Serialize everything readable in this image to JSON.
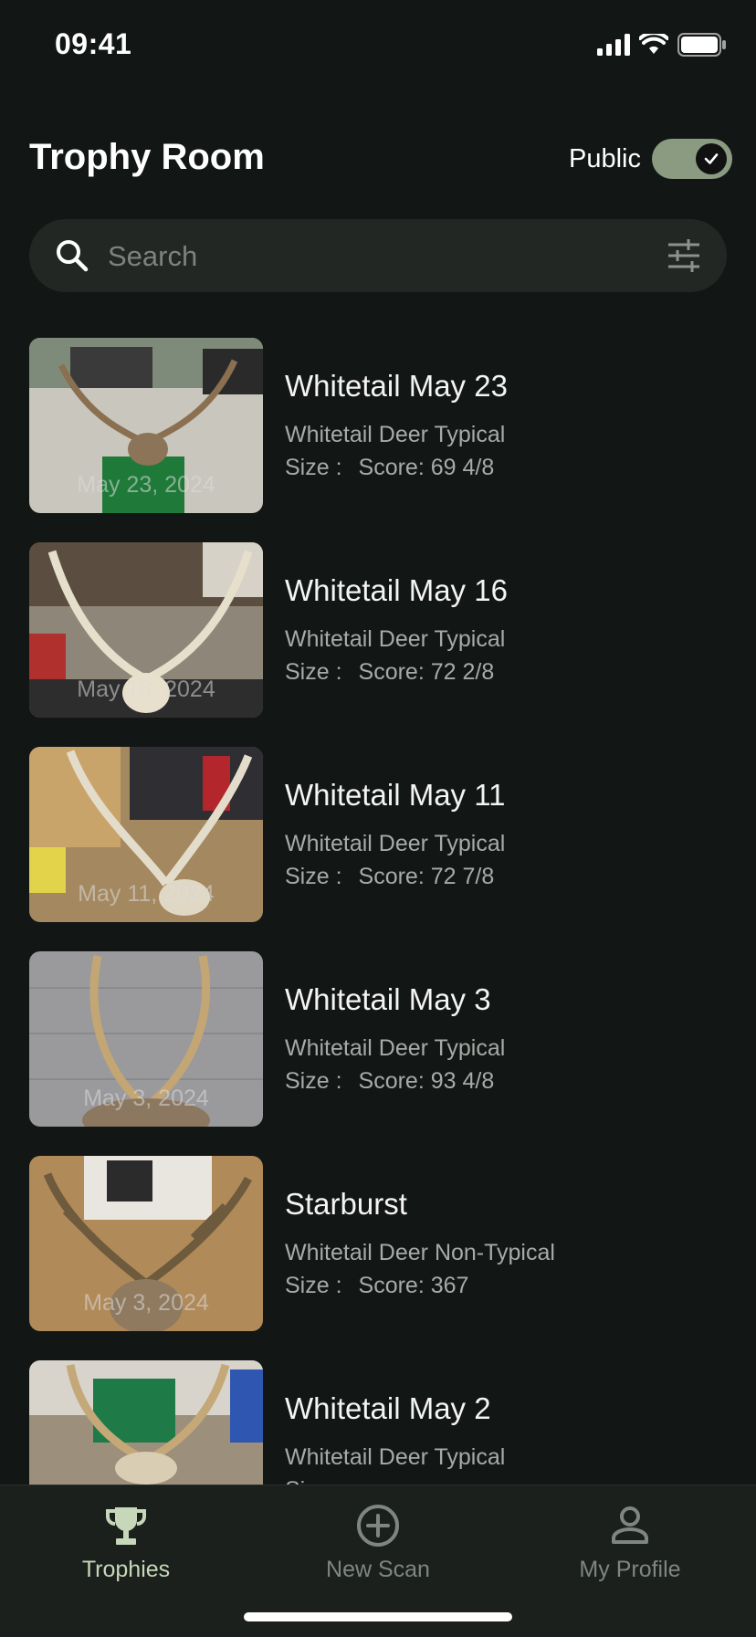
{
  "status_bar": {
    "time": "09:41"
  },
  "header": {
    "title": "Trophy Room",
    "public_label": "Public",
    "public_enabled": true
  },
  "search": {
    "placeholder": "Search"
  },
  "trophies": [
    {
      "title": "Whitetail May 23",
      "category": "Whitetail Deer Typical",
      "size_label": "Size :",
      "score": "Score: 69 4/8",
      "date": "May 23, 2024"
    },
    {
      "title": "Whitetail May 16",
      "category": "Whitetail Deer Typical",
      "size_label": "Size :",
      "score": "Score: 72 2/8",
      "date": "May 16, 2024"
    },
    {
      "title": "Whitetail May 11",
      "category": "Whitetail Deer Typical",
      "size_label": "Size :",
      "score": "Score: 72 7/8",
      "date": "May 11, 2024"
    },
    {
      "title": "Whitetail May 3",
      "category": "Whitetail Deer Typical",
      "size_label": "Size :",
      "score": "Score: 93 4/8",
      "date": "May 3, 2024"
    },
    {
      "title": "Starburst",
      "category": "Whitetail Deer Non-Typical",
      "size_label": "Size :",
      "score": "Score: 367",
      "date": "May 3, 2024"
    },
    {
      "title": "Whitetail May 2",
      "category": "Whitetail Deer Typical",
      "size_label": "Size :",
      "score": "",
      "date": ""
    }
  ],
  "tabs": [
    {
      "label": "Trophies",
      "icon": "trophy-icon",
      "active": true
    },
    {
      "label": "New Scan",
      "icon": "plus-circle-icon",
      "active": false
    },
    {
      "label": "My Profile",
      "icon": "person-icon",
      "active": false
    }
  ],
  "colors": {
    "background": "#121614",
    "toggle_on": "#8a9b82",
    "active_tab": "#c7d7b9",
    "inactive_tab": "#7f8581"
  }
}
